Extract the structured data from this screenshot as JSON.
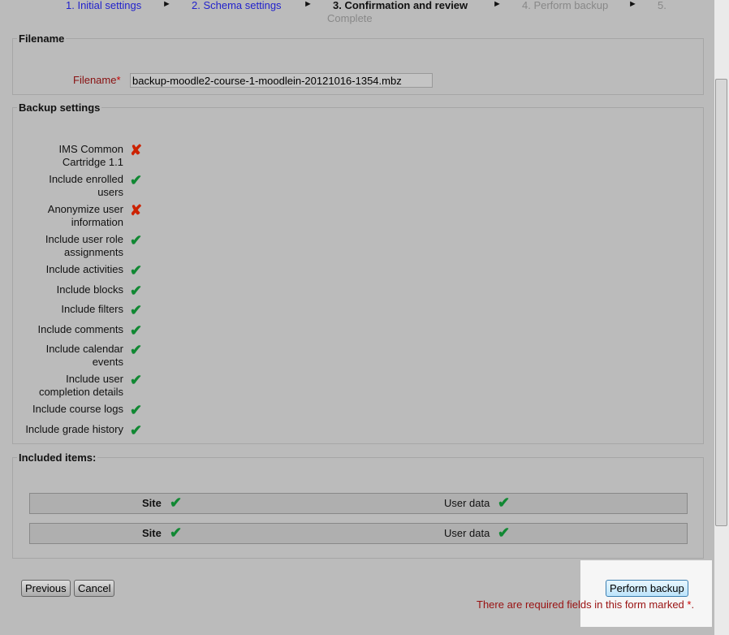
{
  "steps": [
    {
      "label": "1. Initial settings"
    },
    {
      "label": "2. Schema settings"
    },
    {
      "label": "3. Confirmation and review"
    },
    {
      "label": "4. Perform backup"
    },
    {
      "label": "5."
    },
    {
      "label": "Complete"
    }
  ],
  "arrow": "►",
  "filename_section": {
    "legend": "Filename",
    "label": "Filename",
    "required": "*",
    "value": "backup-moodle2-course-1-moodlein-20121016-1354.mbz"
  },
  "backup_settings": {
    "legend": "Backup settings",
    "items": [
      {
        "l1": "IMS Common",
        "l2": "Cartridge 1.1",
        "icon": "✘"
      },
      {
        "l1": "Include enrolled",
        "l2": "users",
        "icon": "✔"
      },
      {
        "l1": "Anonymize user",
        "l2": "information",
        "icon": "✘"
      },
      {
        "l1": "Include user role",
        "l2": "assignments",
        "icon": "✔"
      },
      {
        "l1": "Include activities",
        "icon": "✔"
      },
      {
        "l1": "Include blocks",
        "icon": "✔"
      },
      {
        "l1": "Include filters",
        "icon": "✔"
      },
      {
        "l1": "Include comments",
        "icon": "✔"
      },
      {
        "l1": "Include calendar",
        "l2": "events",
        "icon": "✔"
      },
      {
        "l1": "Include user",
        "l2": "completion details",
        "icon": "✔"
      },
      {
        "l1": "Include course logs",
        "icon": "✔"
      },
      {
        "l1": "Include grade history",
        "icon": "✔"
      }
    ]
  },
  "included": {
    "legend": "Included items:",
    "rows": [
      {
        "site": "Site",
        "userdata": "User data",
        "icon": "✔"
      },
      {
        "site": "Site",
        "userdata": "User data",
        "icon": "✔"
      }
    ]
  },
  "buttons": {
    "previous": "Previous",
    "cancel": "Cancel",
    "perform": "Perform backup"
  },
  "required_note": {
    "text": "There are required fields in this form marked",
    "star": "*",
    "end": "."
  }
}
